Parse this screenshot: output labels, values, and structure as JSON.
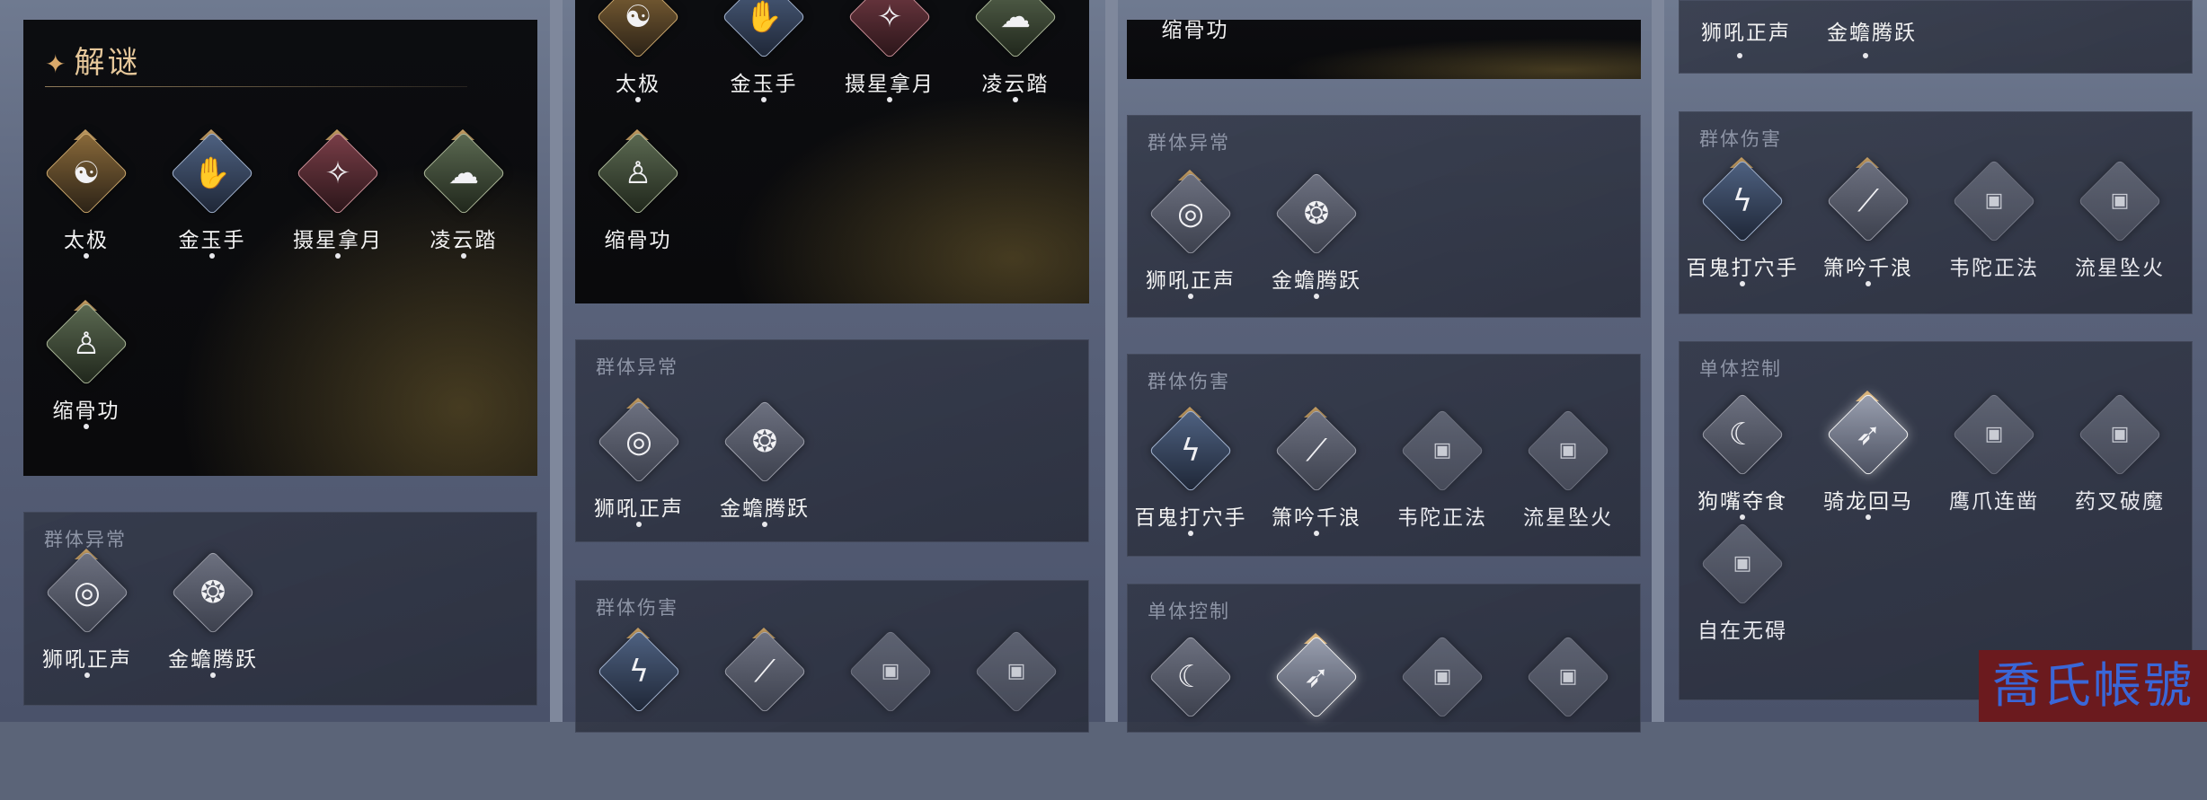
{
  "puzzle_title": "解谜",
  "title_icon": "sparkle-icon",
  "puzzle_skills": [
    {
      "name": "太极",
      "icon": "taiji-icon"
    },
    {
      "name": "金玉手",
      "icon": "golden-hand-icon"
    },
    {
      "name": "摄星拿月",
      "icon": "star-grab-icon"
    },
    {
      "name": "凌云踏",
      "icon": "cloud-step-icon"
    },
    {
      "name": "缩骨功",
      "icon": "bone-shrink-icon"
    }
  ],
  "group_titles": {
    "group_status": "群体异常",
    "group_damage": "群体伤害",
    "single_control": "单体控制"
  },
  "group_status_skills": [
    {
      "name": "狮吼正声"
    },
    {
      "name": "金蟾腾跃"
    }
  ],
  "group_damage_skills": [
    {
      "name": "百鬼打穴手"
    },
    {
      "name": "箫吟千浪"
    },
    {
      "name": "韦陀正法"
    },
    {
      "name": "流星坠火"
    }
  ],
  "single_control_skills": [
    {
      "name": "狗嘴夺食"
    },
    {
      "name": "骑龙回马"
    },
    {
      "name": "鹰爪连凿"
    },
    {
      "name": "药叉破魔"
    },
    {
      "name": "自在无碍"
    }
  ],
  "watermark": "喬氏帳號"
}
